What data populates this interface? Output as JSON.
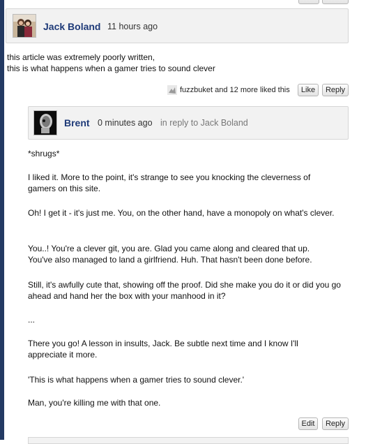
{
  "top_comment": {
    "author": "Jack Boland",
    "time": "11 hours ago",
    "body": [
      "this article was extremely poorly written,",
      "this is what happens when a gamer tries to sound clever"
    ],
    "likes_text": "fuzzbuket and 12 more liked this",
    "like_label": "Like",
    "reply_label": "Reply"
  },
  "reply_comment": {
    "author": "Brent",
    "time": "0 minutes ago",
    "in_reply_to": "in reply to Jack Boland",
    "paragraphs": [
      "*shrugs*",
      "I liked it.  More to the point, it's strange to see you knocking the cleverness of gamers on this site.",
      "Oh!  I get it - it's just me.  You, on the other hand, have a monopoly on what's clever.",
      "You..!  You're a clever git, you are.  Glad you came along and cleared that up.  You've also managed to land a girlfriend.  Huh.  That hasn't been done before.",
      "Still, it's awfully cute that, showing off the proof.  Did she make you do it or did you go ahead and hand her the box with your manhood in it?",
      "...",
      "There you go!  A lesson in insults, Jack.  Be subtle next time and I know I'll appreciate it more.",
      "'This is what happens when a gamer tries to sound clever.'",
      "Man, you're killing me with that one."
    ],
    "edit_label": "Edit",
    "reply_label": "Reply"
  },
  "colors": {
    "author": "#1e3a78",
    "header_bg": "#f2f2f2",
    "rail": "#233a63"
  }
}
